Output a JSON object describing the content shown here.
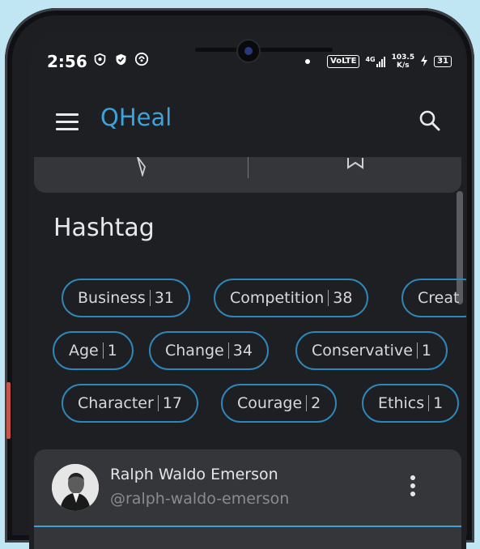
{
  "status_bar": {
    "time": "2:56",
    "network": "VoLTE",
    "signal": "4G",
    "speed_value": "103.5",
    "speed_unit": "K/s",
    "battery": "31"
  },
  "app_bar": {
    "title": "QHeal",
    "menu_icon": "hamburger-menu-icon",
    "search_icon": "search-icon",
    "title_color": "#3ea2d8"
  },
  "quote_card_actions": {
    "share_icon": "send-icon",
    "bookmark_icon": "bookmark-icon"
  },
  "hashtag_section": {
    "title": "Hashtag",
    "chips": [
      {
        "name": "Business",
        "count": "31"
      },
      {
        "name": "Competition",
        "count": "38"
      },
      {
        "name": "Creat",
        "count": ""
      },
      {
        "name": "Age",
        "count": "1"
      },
      {
        "name": "Change",
        "count": "34"
      },
      {
        "name": "Conservative",
        "count": "1"
      },
      {
        "name": "Character",
        "count": "17"
      },
      {
        "name": "Courage",
        "count": "2"
      },
      {
        "name": "Ethics",
        "count": "1"
      }
    ],
    "chip_border_color": "#2f86b8"
  },
  "author_card": {
    "name": "Ralph Waldo Emerson",
    "handle": "@ralph-waldo-emerson",
    "more_icon": "more-vertical-icon"
  }
}
